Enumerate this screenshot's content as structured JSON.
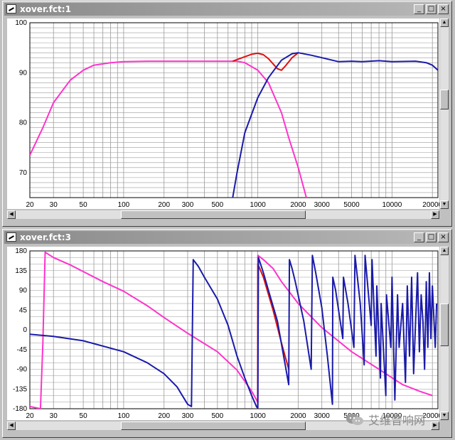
{
  "windows": [
    {
      "title": "xover.fct:1",
      "controls": {
        "minimize": "_",
        "maximize": "□",
        "close": "×"
      }
    },
    {
      "title": "xover.fct:3",
      "controls": {
        "minimize": "_",
        "maximize": "□",
        "close": "×"
      }
    }
  ],
  "watermark": {
    "text": "艾维音响网"
  },
  "chart_data": [
    {
      "type": "line",
      "title": "",
      "xlabel": "",
      "ylabel": "",
      "xscale": "log",
      "xlim": [
        20,
        22000
      ],
      "ylim": [
        65,
        100
      ],
      "yticks": [
        "100",
        "90",
        "80",
        "70"
      ],
      "ytick_values": [
        100,
        90,
        80,
        70
      ],
      "xticks": [
        "20",
        "30",
        "50",
        "100",
        "200",
        "300",
        "500",
        "1000",
        "2000",
        "3000",
        "5000",
        "10000",
        "20000"
      ],
      "xtick_values": [
        20,
        30,
        50,
        100,
        200,
        300,
        500,
        1000,
        2000,
        3000,
        5000,
        10000,
        20000
      ],
      "grid": true,
      "series": [
        {
          "color": "#ff33cc",
          "x": [
            20,
            25,
            30,
            40,
            50,
            60,
            80,
            100,
            150,
            200,
            300,
            500,
            700,
            800,
            1000,
            1200,
            1500,
            1700,
            2000,
            2300
          ],
          "y": [
            73.5,
            79,
            84,
            88.5,
            90.5,
            91.5,
            92,
            92.2,
            92.3,
            92.3,
            92.3,
            92.3,
            92.3,
            92,
            90.5,
            88,
            82,
            77,
            71,
            65
          ]
        },
        {
          "color": "#dd1111",
          "x": [
            650,
            800,
            900,
            1000,
            1100,
            1200,
            1400,
            1500,
            1600,
            1800,
            2000
          ],
          "y": [
            92.3,
            93.2,
            93.7,
            93.9,
            93.6,
            92.8,
            90.8,
            90.5,
            91.3,
            93,
            94
          ]
        },
        {
          "color": "#1a1aaa",
          "x": [
            650,
            700,
            800,
            1000,
            1200,
            1500,
            1800,
            2000,
            2500,
            3000,
            4000,
            5000,
            6000,
            8000,
            10000,
            15000,
            18000,
            20000,
            22000
          ],
          "y": [
            65,
            70,
            78,
            85,
            89,
            92.5,
            93.8,
            94,
            93.5,
            93,
            92.2,
            92.3,
            92.2,
            92.4,
            92.2,
            92.3,
            92,
            91.5,
            90.5
          ]
        }
      ]
    },
    {
      "type": "line",
      "title": "",
      "xlabel": "",
      "ylabel": "",
      "xscale": "log",
      "xlim": [
        20,
        22000
      ],
      "ylim": [
        -180,
        180
      ],
      "yticks": [
        "180",
        "135",
        "90",
        "45",
        "0",
        "-45",
        "-90",
        "-135",
        "-180"
      ],
      "ytick_values": [
        180,
        135,
        90,
        45,
        0,
        -45,
        -90,
        -135,
        -180
      ],
      "xticks": [
        "20",
        "30",
        "50",
        "100",
        "200",
        "300",
        "500",
        "1000",
        "2000",
        "3000",
        "5000",
        "10000",
        "20000"
      ],
      "xtick_values": [
        20,
        30,
        50,
        100,
        200,
        300,
        500,
        1000,
        2000,
        3000,
        5000,
        10000,
        20000
      ],
      "grid": true,
      "series": [
        {
          "color": "#ff33cc",
          "x": [
            20,
            24,
            25,
            26,
            30,
            40,
            50,
            70,
            100,
            150,
            200,
            300,
            500,
            700,
            900,
            1000,
            1001,
            1100,
            1300,
            1500,
            2000,
            3000,
            5000,
            8000,
            12000,
            16000,
            20000
          ],
          "y": [
            -175,
            -180,
            -30,
            177,
            165,
            148,
            133,
            110,
            88,
            55,
            28,
            -8,
            -50,
            -92,
            -140,
            -165,
            170,
            160,
            140,
            110,
            60,
            5,
            -50,
            -90,
            -125,
            -140,
            -150
          ]
        },
        {
          "color": "#dd1111",
          "x": [
            1000,
            1001,
            1100,
            1300,
            1500,
            1700
          ],
          "y": [
            -178,
            150,
            120,
            45,
            -30,
            -90
          ]
        },
        {
          "color": "#1a1aaa",
          "x": [
            20,
            30,
            50,
            100,
            150,
            200,
            250,
            300,
            320,
            330,
            360,
            400,
            500,
            600,
            700,
            800,
            900,
            980,
            1000,
            1010,
            1100,
            1200,
            1400,
            1700,
            1720,
            1800,
            1900,
            2200,
            2500,
            2550,
            2700,
            3000,
            3300,
            3600,
            3620,
            3800,
            4300,
            4350,
            4700,
            5200,
            5300,
            5800,
            6200,
            6300,
            7000,
            7100,
            7600,
            7700,
            8200,
            8300,
            9000,
            9100,
            9800,
            10000,
            10500,
            11000,
            11300,
            12000,
            12600,
            13000,
            13500,
            14000,
            14500,
            15000,
            15500,
            16000,
            16500,
            17000,
            17500,
            18000,
            18500,
            19000,
            19500,
            20000,
            21000,
            21500
          ],
          "y": [
            -10,
            -15,
            -25,
            -50,
            -75,
            -100,
            -130,
            -170,
            -175,
            160,
            145,
            120,
            70,
            10,
            -60,
            -110,
            -150,
            -176,
            -178,
            165,
            130,
            90,
            20,
            -125,
            160,
            140,
            110,
            20,
            -90,
            170,
            130,
            50,
            -60,
            -170,
            120,
            90,
            -20,
            120,
            60,
            -40,
            170,
            60,
            -80,
            170,
            10,
            160,
            -60,
            100,
            -110,
            60,
            -150,
            80,
            -40,
            120,
            -160,
            80,
            -40,
            60,
            -120,
            100,
            -60,
            120,
            -100,
            20,
            130,
            -50,
            80,
            20,
            -90,
            110,
            -40,
            130,
            -20,
            100,
            -40,
            60
          ]
        }
      ]
    }
  ]
}
